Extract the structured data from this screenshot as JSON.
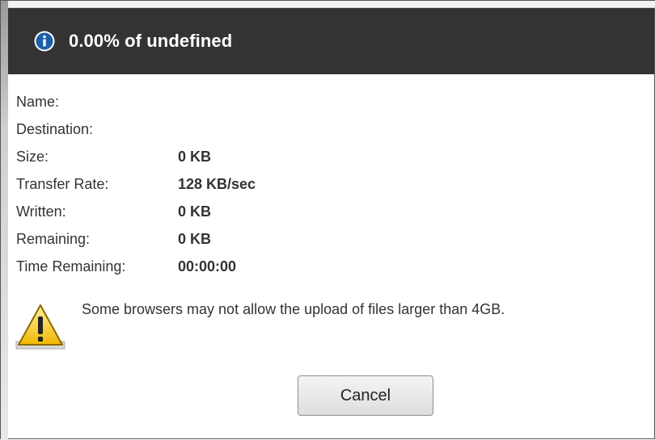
{
  "dialog": {
    "title": "0.00% of undefined",
    "progress_percent": 0
  },
  "details": [
    {
      "label": "Name:",
      "value": ""
    },
    {
      "label": "Destination:",
      "value": ""
    },
    {
      "label": "Size:",
      "value": "0 KB"
    },
    {
      "label": "Transfer Rate:",
      "value": "128 KB/sec"
    },
    {
      "label": "Written:",
      "value": "0 KB"
    },
    {
      "label": "Remaining:",
      "value": "0 KB"
    },
    {
      "label": "Time Remaining:",
      "value": "00:00:00"
    }
  ],
  "warning": {
    "icon": "warning-icon",
    "text": "Some browsers may not allow the upload of files larger than 4GB."
  },
  "buttons": {
    "cancel_label": "Cancel"
  },
  "colors": {
    "titlebar": "#333333",
    "info_icon": "#1a5fa8",
    "warning_icon": "#f2c400"
  }
}
